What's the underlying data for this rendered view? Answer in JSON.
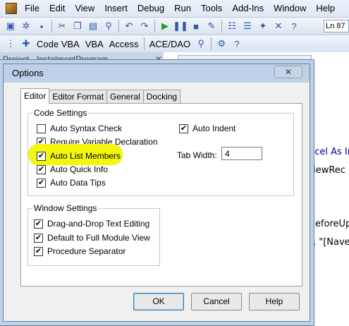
{
  "menubar": {
    "items": [
      "File",
      "Edit",
      "View",
      "Insert",
      "Debug",
      "Run",
      "Tools",
      "Add-Ins",
      "Window",
      "Help"
    ]
  },
  "toolbar2": {
    "items": [
      "Code VBA",
      "VBA",
      "Access",
      "ACE/DAO"
    ]
  },
  "status": {
    "line_number": "Ln 87"
  },
  "project_pane": {
    "title": "Project - InstalmentProgram"
  },
  "code_pane": {
    "lines": [
      "ncel As In",
      "NewRec",
      "BeforeUp",
      "\", \"[NaveN"
    ]
  },
  "dialog": {
    "title": "Options",
    "close_glyph": "✕",
    "tabs": [
      "Editor",
      "Editor Format",
      "General",
      "Docking"
    ],
    "active_tab": "Editor",
    "code_settings": {
      "label": "Code Settings",
      "options": [
        {
          "label": "Auto Syntax Check",
          "checked": false
        },
        {
          "label": "Require Variable Declaration",
          "checked": true
        },
        {
          "label": "Auto List Members",
          "checked": true
        },
        {
          "label": "Auto Quick Info",
          "checked": true
        },
        {
          "label": "Auto Data Tips",
          "checked": true
        }
      ],
      "auto_indent": {
        "label": "Auto Indent",
        "checked": true
      },
      "tab_width": {
        "label": "Tab Width:",
        "value": "4"
      }
    },
    "window_settings": {
      "label": "Window Settings",
      "options": [
        {
          "label": "Drag-and-Drop Text Editing",
          "checked": true
        },
        {
          "label": "Default to Full Module View",
          "checked": true
        },
        {
          "label": "Procedure Separator",
          "checked": true
        }
      ]
    },
    "buttons": {
      "ok": "OK",
      "cancel": "Cancel",
      "help": "Help"
    },
    "highlight_color": "#f3f70e"
  }
}
